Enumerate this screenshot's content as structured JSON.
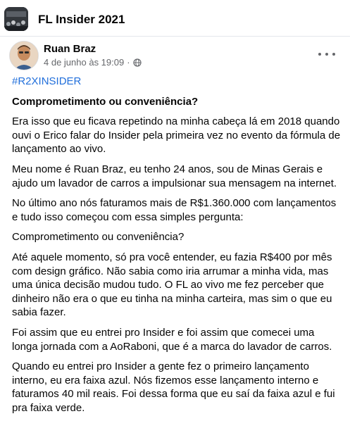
{
  "group": {
    "title": "FL Insider 2021",
    "thumb_icon": "group-cover-image"
  },
  "post": {
    "author": "Ruan Braz",
    "timestamp": "4 de junho às 19:09",
    "separator": "·",
    "privacy_icon": "globe-icon",
    "more_icon": "more-options-icon",
    "hashtag": "#R2XINSIDER",
    "title": "Comprometimento ou conveniência?",
    "paragraphs": [
      "Era isso que eu ficava repetindo na minha cabeça lá em 2018 quando ouvi o Erico falar do Insider pela primeira vez no evento da fórmula de lançamento ao vivo.",
      "Meu nome é Ruan Braz, eu tenho 24 anos, sou de Minas Gerais e ajudo um lavador de carros a impulsionar sua mensagem na internet.",
      "No último ano nós faturamos mais de R$1.360.000 com lançamentos e tudo isso começou com essa simples pergunta:",
      "Comprometimento ou conveniência?",
      "Até aquele momento, só pra você entender, eu fazia R$400 por mês com design gráfico. Não sabia como iria arrumar a minha vida, mas uma única decisão mudou tudo. O FL ao vivo me fez perceber que dinheiro não era o que eu tinha na minha carteira, mas sim o que eu sabia fazer.",
      "Foi assim que eu entrei pro Insider e foi assim que comecei uma longa jornada com a AoRaboni, que é a marca do lavador de carros.",
      "Quando eu entrei pro Insider a gente fez o primeiro lançamento interno, eu era faixa azul. Nós fizemos esse lançamento interno e faturamos 40 mil reais. Foi dessa forma que eu saí da faixa azul e fui pra faixa verde."
    ]
  },
  "colors": {
    "link": "#216fdb",
    "secondary_text": "#65676b",
    "text": "#050505"
  }
}
